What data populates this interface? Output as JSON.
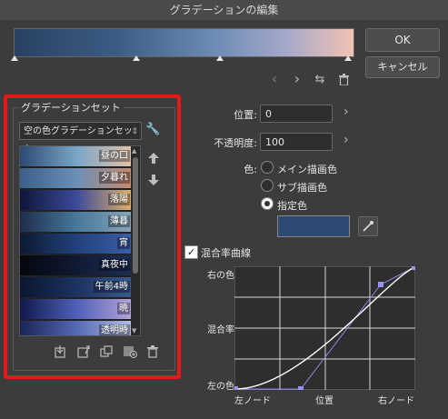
{
  "window": {
    "title": "グラデーションの編集"
  },
  "buttons": {
    "ok": "OK",
    "cancel": "キャンセル"
  },
  "gradient": {
    "colors": [
      "#294263",
      "#3c5c84",
      "#6f8db6",
      "#a5a8c9",
      "#f3c2b4"
    ]
  },
  "preset_set": {
    "group_title": "グラデーションセット",
    "selected": "空の色グラデーションセット",
    "items": [
      {
        "label": "昼の口"
      },
      {
        "label": "夕暮れ"
      },
      {
        "label": "落陽"
      },
      {
        "label": "薄暮"
      },
      {
        "label": "宵"
      },
      {
        "label": "真夜中"
      },
      {
        "label": "午前4時"
      },
      {
        "label": "暁"
      },
      {
        "label": "透明時"
      }
    ]
  },
  "props": {
    "position_label": "位置:",
    "position_value": "0",
    "opacity_label": "不透明度:",
    "opacity_value": "100",
    "color_label": "色:",
    "color_options": [
      "メイン描画色",
      "サブ描画色",
      "指定色"
    ],
    "selected_color_option": "指定色",
    "color_swatch": "#2c4a73"
  },
  "curve": {
    "checkbox_label": "混合率曲線",
    "checked": true,
    "y_top": "右の色",
    "y_mid": "混合率",
    "y_bottom": "左の色",
    "x_left": "左ノード",
    "x_mid": "位置",
    "x_right": "右ノード"
  }
}
